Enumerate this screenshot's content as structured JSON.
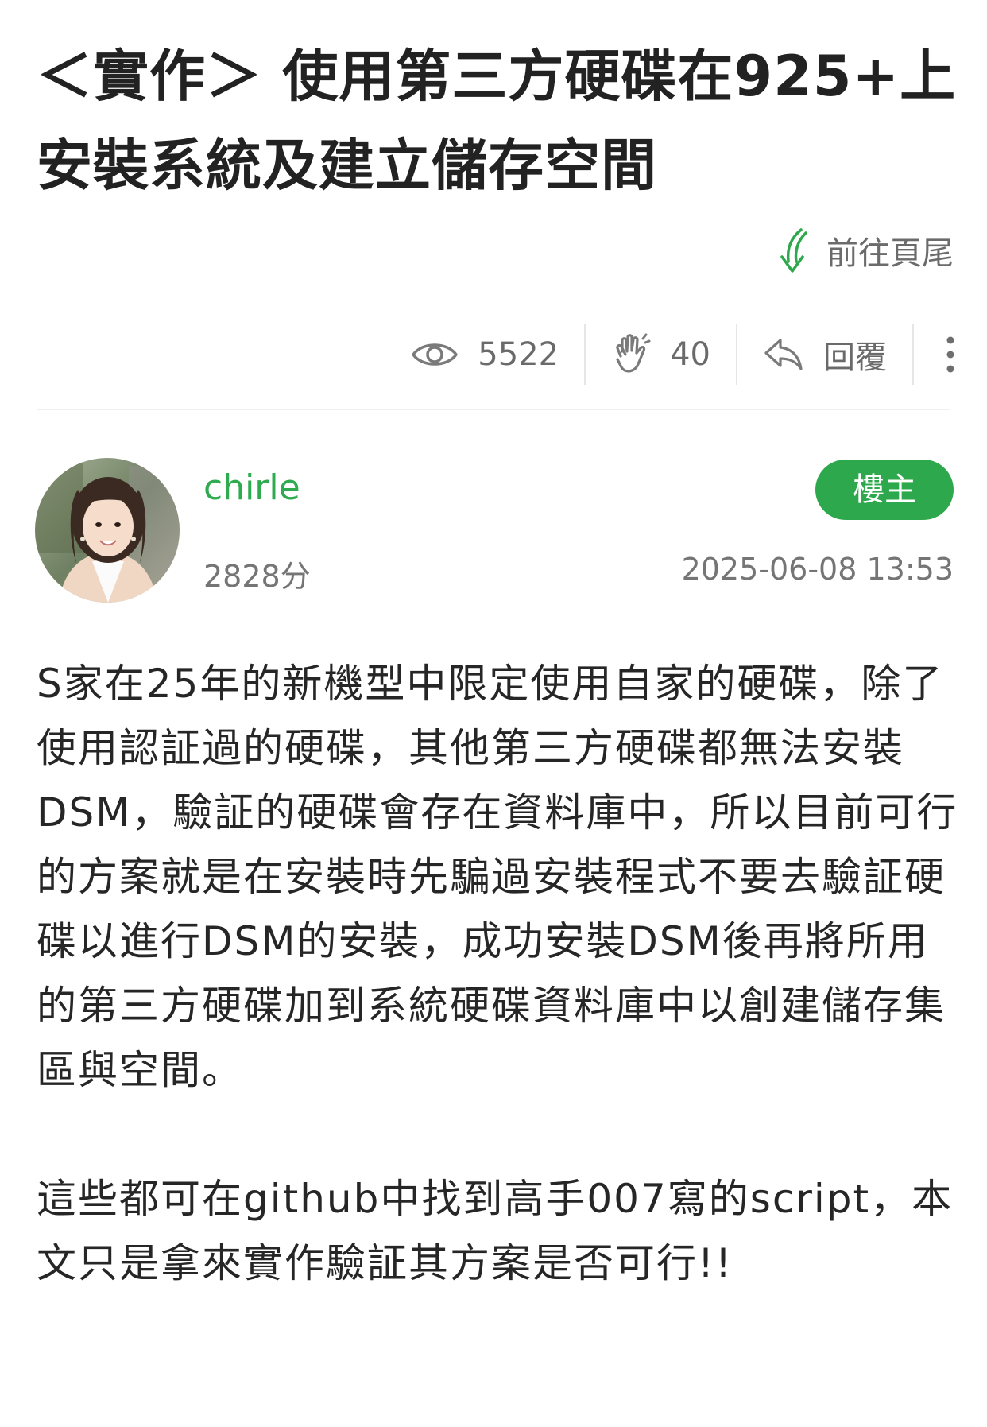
{
  "post": {
    "title": "＜實作＞ 使用第三方硬碟在925+上安裝系統及建立儲存空間",
    "goto_footer_label": "前往頁尾",
    "stats": {
      "views": "5522",
      "likes": "40",
      "reply_label": "回覆"
    },
    "author": {
      "name": "chirle",
      "score": "2828分",
      "badge": "樓主",
      "timestamp": "2025-06-08 13:53"
    },
    "paragraphs": [
      "S家在25年的新機型中限定使用自家的硬碟，除了使用認証過的硬碟，其他第三方硬碟都無法安裝DSM，驗証的硬碟會存在資料庫中，所以目前可行的方案就是在安裝時先騙過安裝程式不要去驗証硬碟以進行DSM的安裝，成功安裝DSM後再將所用的第三方硬碟加到系統硬碟資料庫中以創建儲存集區與空間。",
      "這些都可在github中找到高手007寫的script，本文只是拿來實作驗証其方案是否可行!!"
    ]
  },
  "icons": {
    "goto_footer": "down-arrow-icon",
    "views": "eye-icon",
    "likes": "clap-icon",
    "reply": "reply-icon",
    "more": "more-vertical-icon"
  },
  "colors": {
    "accent_green": "#2ea84c",
    "username_green": "#2eaa4f",
    "muted_text": "#757575"
  }
}
